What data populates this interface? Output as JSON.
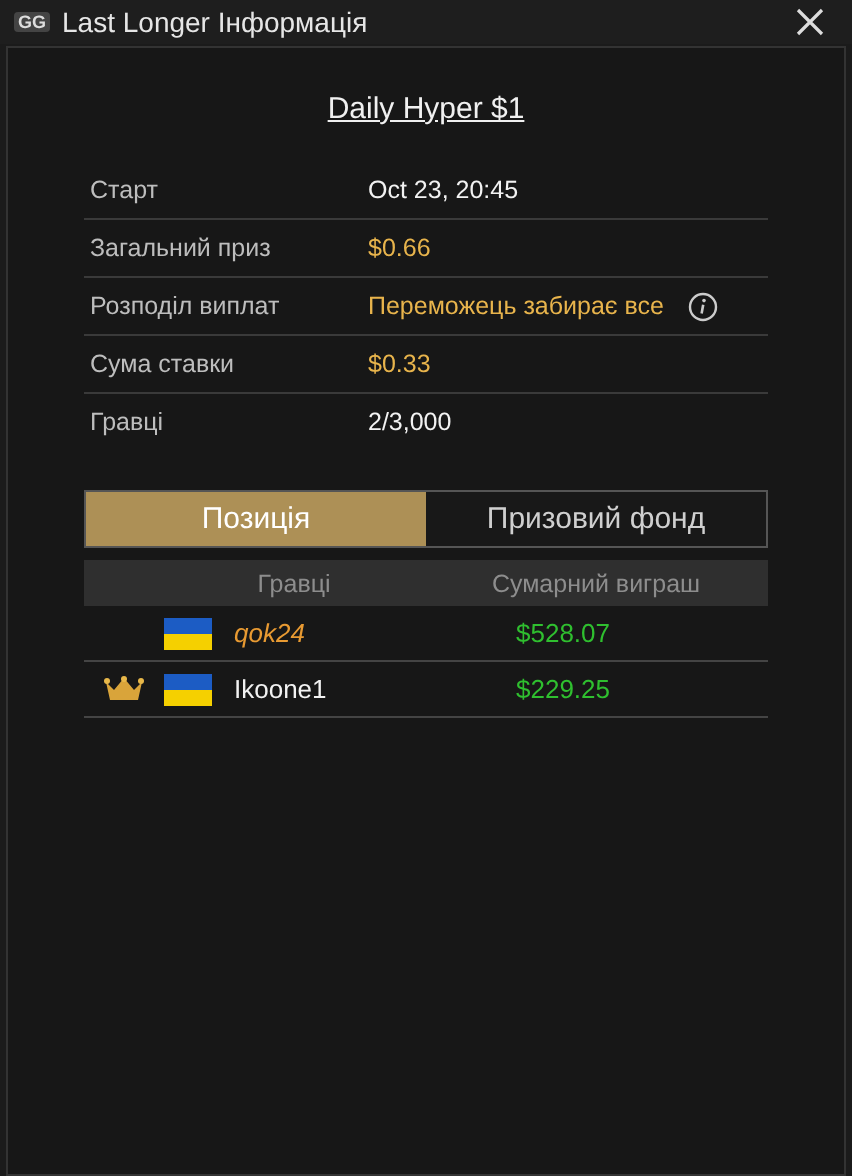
{
  "window": {
    "title": "Last Longer Інформація",
    "logo": "GG"
  },
  "tournament": {
    "name": "Daily Hyper $1"
  },
  "info_rows": [
    {
      "label": "Старт",
      "value": "Oct 23, 20:45",
      "highlight": false,
      "info": false
    },
    {
      "label": "Загальний приз",
      "value": "$0.66",
      "highlight": true,
      "info": false
    },
    {
      "label": "Розподіл виплат",
      "value": "Переможець забирає все",
      "highlight": true,
      "info": true
    },
    {
      "label": "Сума ставки",
      "value": "$0.33",
      "highlight": true,
      "info": false
    },
    {
      "label": "Гравці",
      "value": "2/3,000",
      "highlight": false,
      "info": false
    }
  ],
  "tabs": [
    {
      "label": "Позиція",
      "selected": true
    },
    {
      "label": "Призовий фонд",
      "selected": false
    }
  ],
  "table": {
    "columns": [
      "Гравці",
      "Сумарний виграш"
    ],
    "rows": [
      {
        "player": "qok24",
        "winnings": "$528.07",
        "self": true,
        "leader": false
      },
      {
        "player": "Ikoone1",
        "winnings": "$229.25",
        "self": false,
        "leader": true
      }
    ]
  }
}
